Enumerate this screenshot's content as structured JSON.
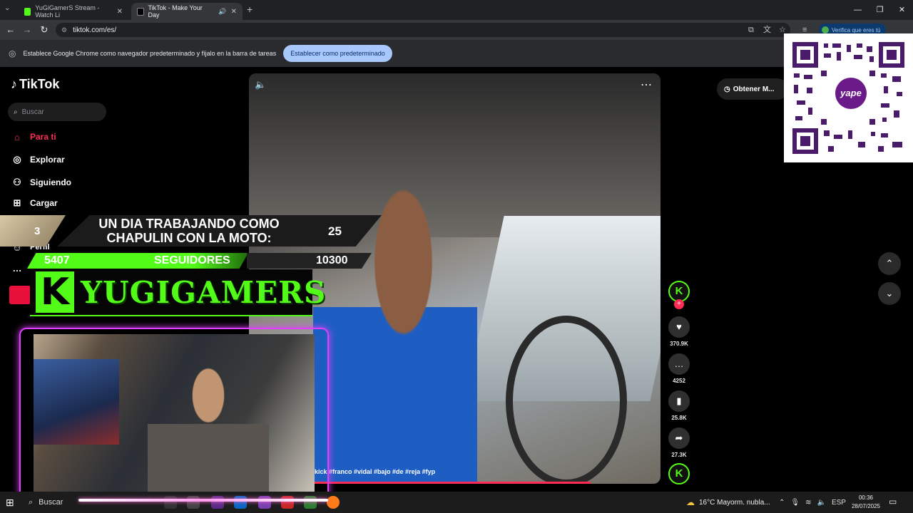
{
  "browser": {
    "tabs": [
      {
        "title": "YuGiGamerS Stream - Watch Li",
        "favicon_color": "#53fc18"
      },
      {
        "title": "TikTok - Make Your Day",
        "favicon_color": "#000000"
      }
    ],
    "url": "tiktok.com/es/",
    "verify_label": "Verifica que eres tú",
    "infobar_text": "Establece Google Chrome como navegador predeterminado y fíjalo en la barra de tareas",
    "infobar_button": "Establecer como predeterminado"
  },
  "tiktok": {
    "logo": "TikTok",
    "search_placeholder": "Buscar",
    "nav": [
      {
        "label": "Para ti",
        "icon": "home-icon",
        "active": true
      },
      {
        "label": "Explorar",
        "icon": "compass-icon"
      },
      {
        "label": "Siguiendo",
        "icon": "following-icon"
      },
      {
        "label": "Cargar",
        "icon": "upload-icon"
      },
      {
        "label": "Perfil",
        "icon": "profile-icon"
      }
    ],
    "more_icon": "…",
    "video": {
      "hashtags": "kick #franco #vidal #bajo #de #reja #fyp",
      "progress": 0.83
    },
    "actions": {
      "likes": "370.9K",
      "comments": "4252",
      "saves": "25.8K",
      "shares": "27.3K"
    },
    "obtener_label": "Obtener M..."
  },
  "overlay": {
    "rank": "3",
    "title": "UN DIA TRABAJANDO COMO CHAPULIN CON LA MOTO:",
    "title_value": "25",
    "followers_current": "5407",
    "followers_label": "SEGUIDORES",
    "followers_goal": "10300",
    "brand": "YUGIGAMERS",
    "brand_letter": "K",
    "accent": "#53fc18"
  },
  "qr": {
    "logo_text": "yape",
    "color": "#4a1a6b"
  },
  "taskbar": {
    "search_label": "Buscar",
    "weather": "16°C  Mayorm. nubla...",
    "lang": "ESP",
    "time": "00:36",
    "date": "28/07/2025"
  }
}
